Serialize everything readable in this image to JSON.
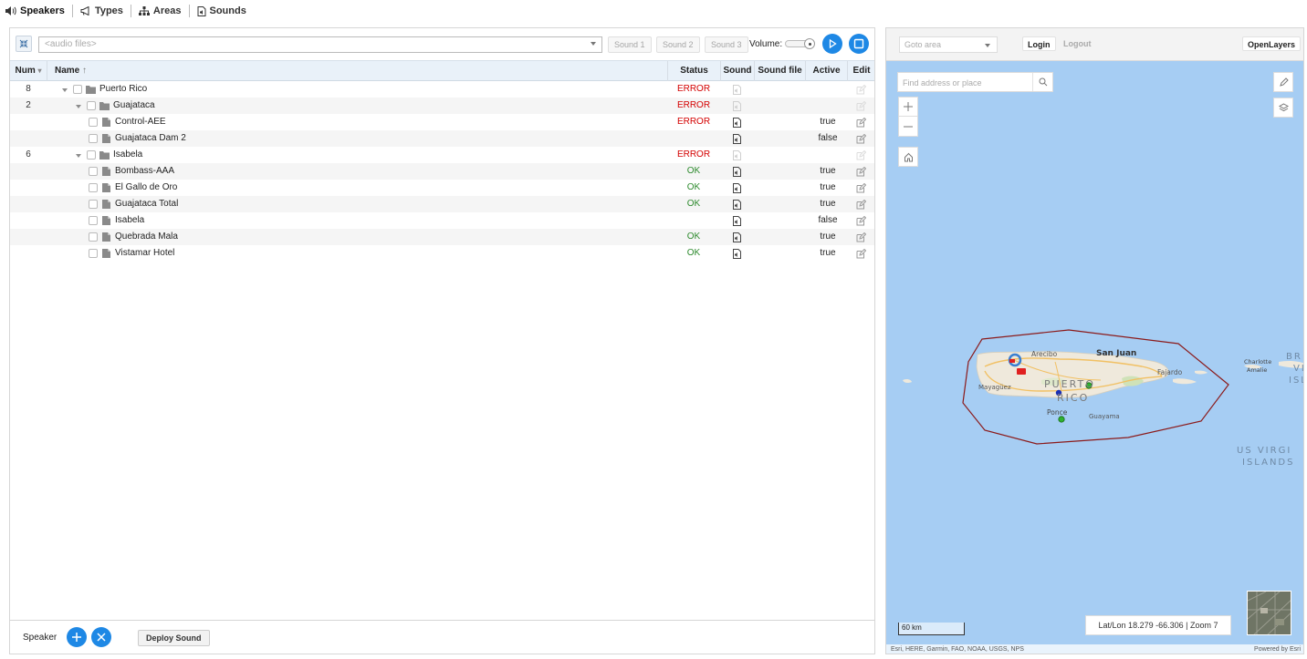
{
  "nav": {
    "speakers": "Speakers",
    "types": "Types",
    "areas": "Areas",
    "sounds": "Sounds"
  },
  "toolbar": {
    "audio_placeholder": "<audio files>",
    "sound1": "Sound 1",
    "sound2": "Sound 2",
    "sound3": "Sound 3",
    "volume_label": "Volume:",
    "volume_level": 1.0
  },
  "table": {
    "headers": {
      "num": "Num",
      "name": "Name",
      "status": "Status",
      "sound": "Sound",
      "sound_file": "Sound file",
      "active": "Active",
      "edit": "Edit"
    },
    "rows": [
      {
        "num": "8",
        "name": "Puerto Rico",
        "type": "folder",
        "level": 0,
        "status": "ERROR",
        "active": ""
      },
      {
        "num": "2",
        "name": "Guajataca",
        "type": "folder",
        "level": 1,
        "status": "ERROR",
        "active": ""
      },
      {
        "num": "",
        "name": "Control-AEE",
        "type": "file",
        "level": 2,
        "status": "ERROR",
        "active": "true"
      },
      {
        "num": "",
        "name": "Guajataca Dam 2",
        "type": "file",
        "level": 2,
        "status": "",
        "active": "false"
      },
      {
        "num": "6",
        "name": "Isabela",
        "type": "folder",
        "level": 1,
        "status": "ERROR",
        "active": ""
      },
      {
        "num": "",
        "name": "Bombass-AAA",
        "type": "file",
        "level": 2,
        "status": "OK",
        "active": "true"
      },
      {
        "num": "",
        "name": "El Gallo de Oro",
        "type": "file",
        "level": 2,
        "status": "OK",
        "active": "true"
      },
      {
        "num": "",
        "name": "Guajataca Total",
        "type": "file",
        "level": 2,
        "status": "OK",
        "active": "true"
      },
      {
        "num": "",
        "name": "Isabela",
        "type": "file",
        "level": 2,
        "status": "",
        "active": "false"
      },
      {
        "num": "",
        "name": "Quebrada Mala",
        "type": "file",
        "level": 2,
        "status": "OK",
        "active": "true"
      },
      {
        "num": "",
        "name": "Vistamar Hotel",
        "type": "file",
        "level": 2,
        "status": "OK",
        "active": "true"
      }
    ]
  },
  "bottom": {
    "speaker_label": "Speaker",
    "deploy_label": "Deploy Sound"
  },
  "map": {
    "goto_placeholder": "Goto area",
    "login": "Login",
    "logout": "Logout",
    "openlayers": "OpenLayers",
    "search_placeholder": "Find address or place",
    "scale_label": "60 km",
    "coords": "Lat/Lon 18.279 -66.306 | Zoom 7",
    "attribution_left": "Esri, HERE, Garmin, FAO, NOAA, USGS, NPS",
    "attribution_right": "Powered by Esri",
    "labels": {
      "arecibo": "Arecibo",
      "san_juan": "San Juan",
      "fajardo": "Fajardo",
      "mayaguez": "Mayagüez",
      "puerto": "PUERTO",
      "rico": "RICO",
      "ponce": "Ponce",
      "guayama": "Guayama",
      "charlotte": "Charlotte",
      "amalie": "Amalie",
      "us_virgin": "US VIRGI",
      "islands": "ISLANDS",
      "br": "BR",
      "vi": "VI",
      "isl": "ISL"
    }
  },
  "colors": {
    "accent": "#1e88e5",
    "error": "#d40000",
    "ok": "#2d8a2d",
    "header_bg": "#e9f1f9",
    "water": "#a6cdf3",
    "land": "#efe9dc",
    "polygon": "#8b1a1a"
  }
}
